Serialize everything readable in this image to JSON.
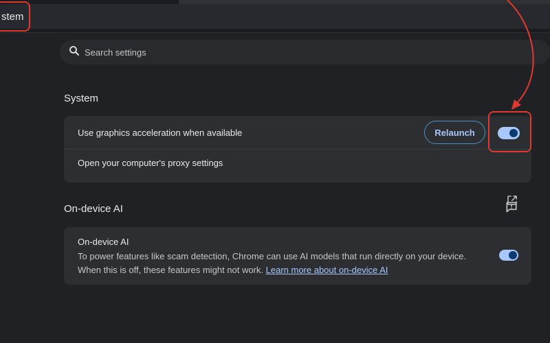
{
  "sidebar": {
    "selected_label": "stem"
  },
  "search": {
    "placeholder": "Search settings"
  },
  "system": {
    "title": "System",
    "graphics_label": "Use graphics acceleration when available",
    "relaunch_label": "Relaunch",
    "graphics_enabled": true,
    "proxy_label": "Open your computer's proxy settings"
  },
  "ondevice": {
    "section_title": "On-device AI",
    "title": "On-device AI",
    "description": "To power features like scam detection, Chrome can use AI models that run directly on your device. When this is off, these features might not work.",
    "learn_more": "Learn more about on-device AI",
    "enabled": true
  },
  "colors": {
    "accent": "#a8c7fa",
    "annotation": "#e03a2f",
    "background": "#202124",
    "card": "#2d2e31"
  },
  "icons": {
    "search": "search-icon",
    "external": "open-in-new-icon",
    "feedback": "feedback-icon"
  }
}
